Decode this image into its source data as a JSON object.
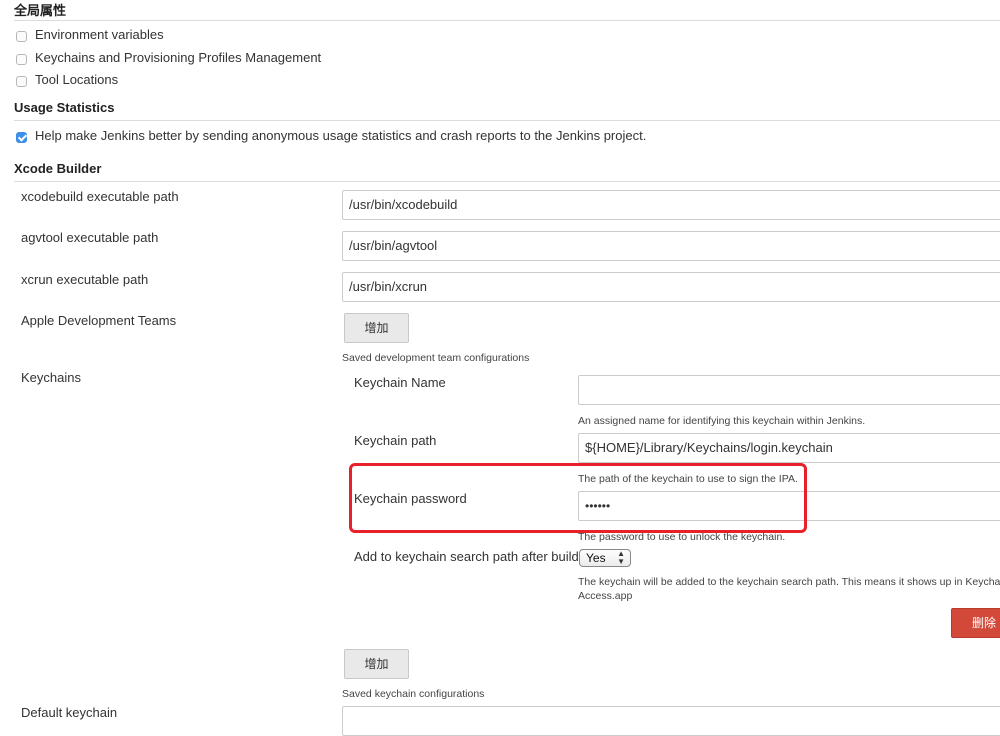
{
  "global_props": {
    "title": "全局属性",
    "items": [
      {
        "label": "Environment variables",
        "checked": false
      },
      {
        "label": "Keychains and Provisioning Profiles Management",
        "checked": false
      },
      {
        "label": "Tool Locations",
        "checked": false
      }
    ]
  },
  "usage": {
    "title": "Usage Statistics",
    "checkbox_label": "Help make Jenkins better by sending anonymous usage statistics and crash reports to the Jenkins project.",
    "checked": true
  },
  "xcode": {
    "title": "Xcode Builder",
    "xcodebuild_label": "xcodebuild executable path",
    "xcodebuild_value": "/usr/bin/xcodebuild",
    "agvtool_label": "agvtool executable path",
    "agvtool_value": "/usr/bin/agvtool",
    "xcrun_label": "xcrun executable path",
    "xcrun_value": "/usr/bin/xcrun",
    "teams_label": "Apple Development Teams",
    "add_label": "增加",
    "teams_help": "Saved development team configurations",
    "keychains_label": "Keychains",
    "keychain": {
      "name_label": "Keychain Name",
      "name_value": "",
      "name_help": "An assigned name for identifying this keychain within Jenkins.",
      "path_label": "Keychain path",
      "path_value": "${HOME}/Library/Keychains/login.keychain",
      "path_help": "The path of the keychain to use to sign the IPA.",
      "password_label": "Keychain password",
      "password_value": "••••••",
      "password_help": "The password to use to unlock the keychain.",
      "search_path_label": "Add to keychain search path after build",
      "search_path_value": "Yes",
      "search_path_help_1": "The keychain will be added to the keychain search path. This means it shows up in Keychain",
      "search_path_help_2": "Access.app",
      "delete_label": "删除"
    },
    "keychains_help": "Saved keychain configurations",
    "default_keychain_label": "Default keychain"
  },
  "colors": {
    "highlight": "#e8202a",
    "delete_button": "#d24939",
    "checkbox_checked": "#3d8ee8"
  }
}
